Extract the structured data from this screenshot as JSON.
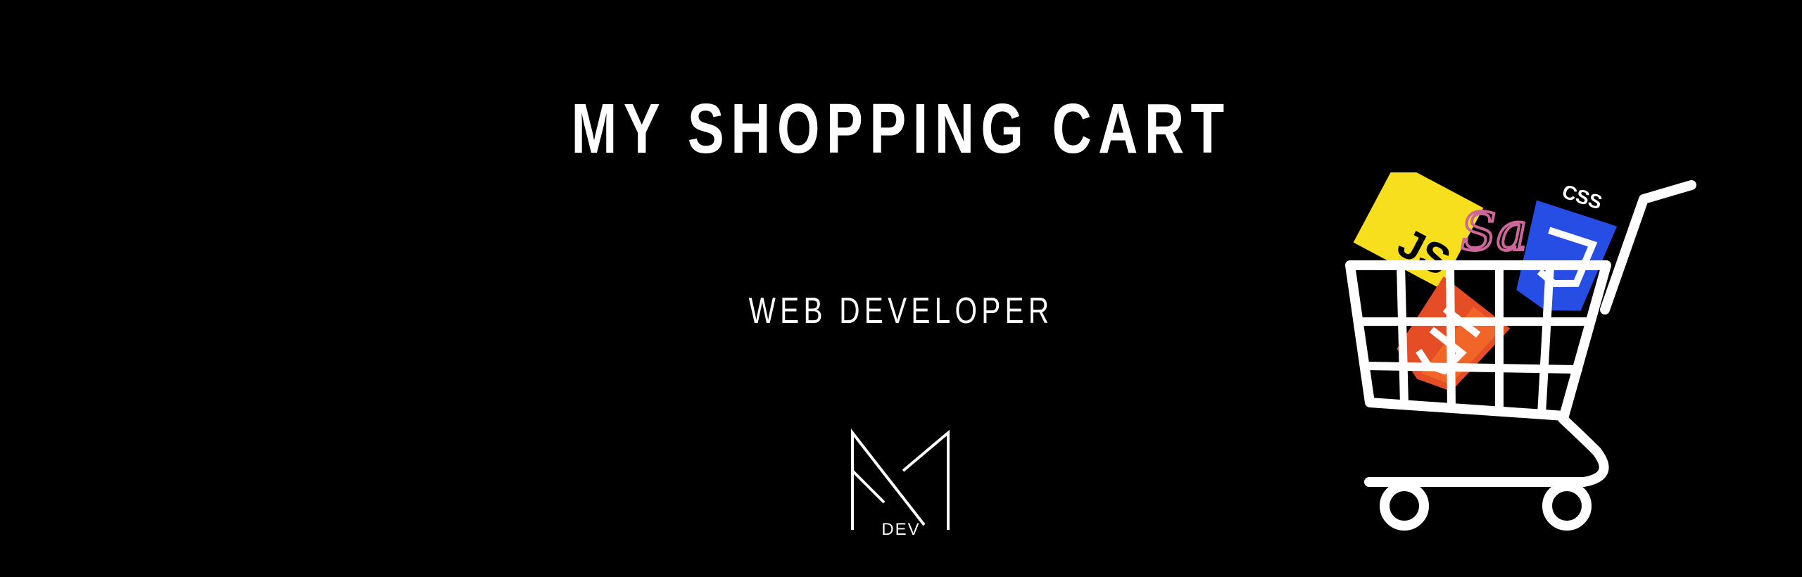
{
  "banner": {
    "title": "MY SHOPPING CART",
    "subtitle": "WEB DEVELOPER",
    "logo": {
      "icon": "m-monogram-icon",
      "text": "DEV"
    },
    "illustration": {
      "icon": "shopping-cart-icon",
      "items": [
        {
          "icon": "javascript-logo-icon",
          "text": "JS",
          "color": "#F7DF1E"
        },
        {
          "icon": "sass-logo-icon",
          "text": "Sass",
          "color": "#CD6799"
        },
        {
          "icon": "css-logo-icon",
          "text": "CSS",
          "color": "#264DE4"
        },
        {
          "icon": "html5-logo-icon",
          "color": "#E44D26"
        }
      ]
    }
  },
  "colors": {
    "background": "#000000",
    "foreground": "#FFFFFF"
  }
}
